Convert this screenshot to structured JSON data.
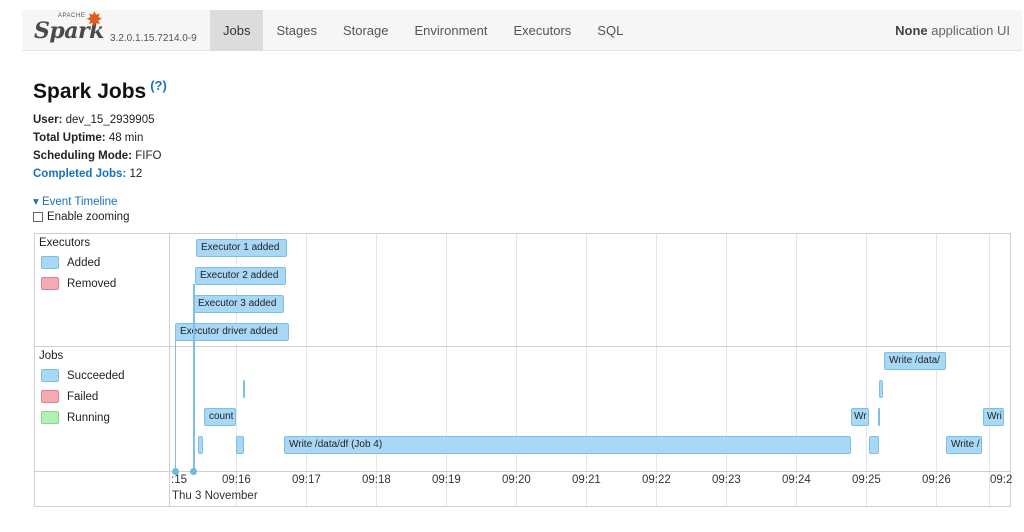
{
  "navbar": {
    "logo_apache": "APACHE",
    "logo_text": "Spark",
    "version": "3.2.0.1.15.7214.0-9",
    "tabs": [
      {
        "label": "Jobs",
        "active": true
      },
      {
        "label": "Stages",
        "active": false
      },
      {
        "label": "Storage",
        "active": false
      },
      {
        "label": "Environment",
        "active": false
      },
      {
        "label": "Executors",
        "active": false
      },
      {
        "label": "SQL",
        "active": false
      }
    ],
    "app_name_bold": "None",
    "app_name_suffix": " application UI"
  },
  "header": {
    "title": "Spark Jobs",
    "help": "(?)"
  },
  "summary": {
    "user_label": "User:",
    "user_value": " dev_15_2939905",
    "uptime_label": "Total Uptime:",
    "uptime_value": " 48 min",
    "scheduling_label": "Scheduling Mode:",
    "scheduling_value": " FIFO",
    "completed_label": "Completed Jobs:",
    "completed_value": " 12"
  },
  "timeline": {
    "toggle_label": "Event Timeline",
    "zoom_label": "Enable zooming",
    "executors_group": "Executors",
    "executors_legend": [
      "Added",
      "Removed"
    ],
    "jobs_group": "Jobs",
    "jobs_legend": [
      "Succeeded",
      "Failed",
      "Running"
    ],
    "executor_items": [
      "Executor 1 added",
      "Executor 2 added",
      "Executor 3 added",
      "Executor driver added"
    ],
    "job_items": {
      "count": "count",
      "write_job4": "Write /data/df (Job 4)",
      "write_top": "Write /data/",
      "wr_a": "Wr",
      "wri_right": "Wri",
      "write_bottom": "Write /"
    },
    "ticks": [
      ":15",
      "09:16",
      "09:17",
      "09:18",
      "09:19",
      "09:20",
      "09:21",
      "09:22",
      "09:23",
      "09:24",
      "09:25",
      "09:26",
      "09:2"
    ],
    "date_label": "Thu 3 November"
  },
  "colors": {
    "succeeded": "#a8d8f5",
    "failed": "#f4a9b3",
    "running": "#b2f0b8",
    "link": "#1a6fbf"
  }
}
